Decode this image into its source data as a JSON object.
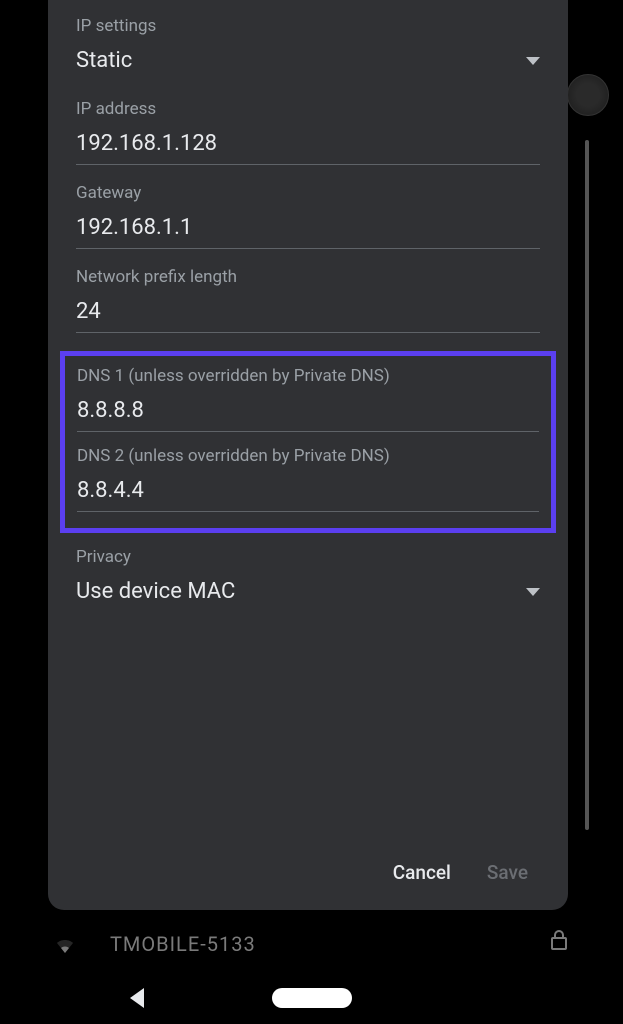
{
  "background": {
    "wifi_name": "TMOBILE-5133"
  },
  "dialog": {
    "ip_settings": {
      "label": "IP settings",
      "value": "Static"
    },
    "ip_address": {
      "label": "IP address",
      "value": "192.168.1.128"
    },
    "gateway": {
      "label": "Gateway",
      "value": "192.168.1.1"
    },
    "prefix": {
      "label": "Network prefix length",
      "value": "24"
    },
    "dns1": {
      "label": "DNS 1 (unless overridden by Private DNS)",
      "value": "8.8.8.8"
    },
    "dns2": {
      "label": "DNS 2 (unless overridden by Private DNS)",
      "value": "8.8.4.4"
    },
    "privacy": {
      "label": "Privacy",
      "value": "Use device MAC"
    },
    "buttons": {
      "cancel": "Cancel",
      "save": "Save"
    }
  }
}
